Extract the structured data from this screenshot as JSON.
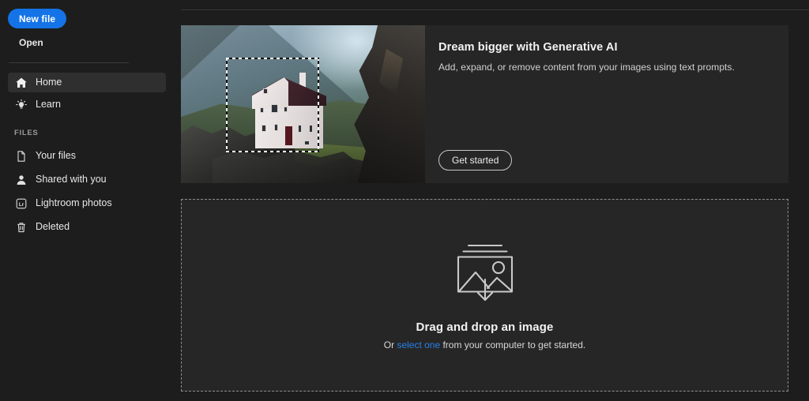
{
  "app": {
    "background": "#1d1d1d",
    "accent_blue": "#1473e6",
    "link_blue": "#2680eb"
  },
  "sidebar": {
    "new_file_label": "New file",
    "open_label": "Open",
    "nav_items": [
      {
        "label": "Home",
        "icon": "home-icon",
        "selected": true
      },
      {
        "label": "Learn",
        "icon": "lightbulb-icon",
        "selected": false
      }
    ],
    "files_heading": "FILES",
    "files_items": [
      {
        "label": "Your files",
        "icon": "document-icon"
      },
      {
        "label": "Shared with you",
        "icon": "person-icon"
      },
      {
        "label": "Lightroom photos",
        "icon": "lightroom-icon"
      },
      {
        "label": "Deleted",
        "icon": "trash-icon"
      }
    ]
  },
  "banner": {
    "title": "Dream bigger with Generative AI",
    "subtitle": "Add, expand, or remove content from your images using text prompts.",
    "cta_label": "Get started",
    "artwork_alt": "white-house-on-green-hill-with-selection-marquee"
  },
  "dropzone": {
    "icon": "image-download-icon",
    "title": "Drag and drop an image",
    "sub_prefix": "Or ",
    "sub_link": "select one",
    "sub_suffix": " from your computer to get started."
  }
}
